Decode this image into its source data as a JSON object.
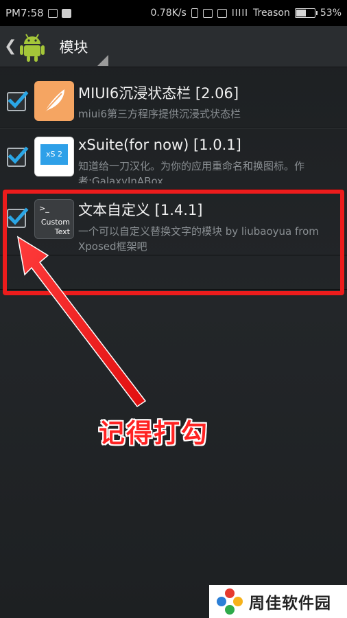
{
  "status_bar": {
    "time": "PM7:58",
    "speed": "0.78K/s",
    "signal": "IIIII",
    "carrier": "Treason",
    "battery": "53%"
  },
  "action_bar": {
    "title": "模块"
  },
  "modules": [
    {
      "title": "MIUI6沉浸状态栏 [2.06]",
      "description": "miui6第三方程序提供沉浸式状态栏",
      "checked": true,
      "icon": "feather-pen-icon",
      "icon_color": "#f5a562"
    },
    {
      "title": "xSuite(for now) [1.0.1]",
      "description": "知道给一刀汉化。为你的应用重命名和换图标。作者:GalaxyInABox",
      "icon_text": "xS 2",
      "checked": true,
      "icon": "xsuite-icon",
      "icon_color": "#2ea0e8"
    },
    {
      "title": "文本自定义 [1.4.1]",
      "description": "一个可以自定义替换文字的模块 by liubaoyua from Xposed框架吧",
      "icon_text_line1": ">_",
      "icon_text_line2": "Custom",
      "icon_text_line3": "Text",
      "checked": true,
      "icon": "custom-text-icon",
      "icon_color": "#3a3d40"
    }
  ],
  "annotation": {
    "text": "记得打勾",
    "color": "#ff2222"
  },
  "watermark": {
    "text": "周佳软件园"
  }
}
